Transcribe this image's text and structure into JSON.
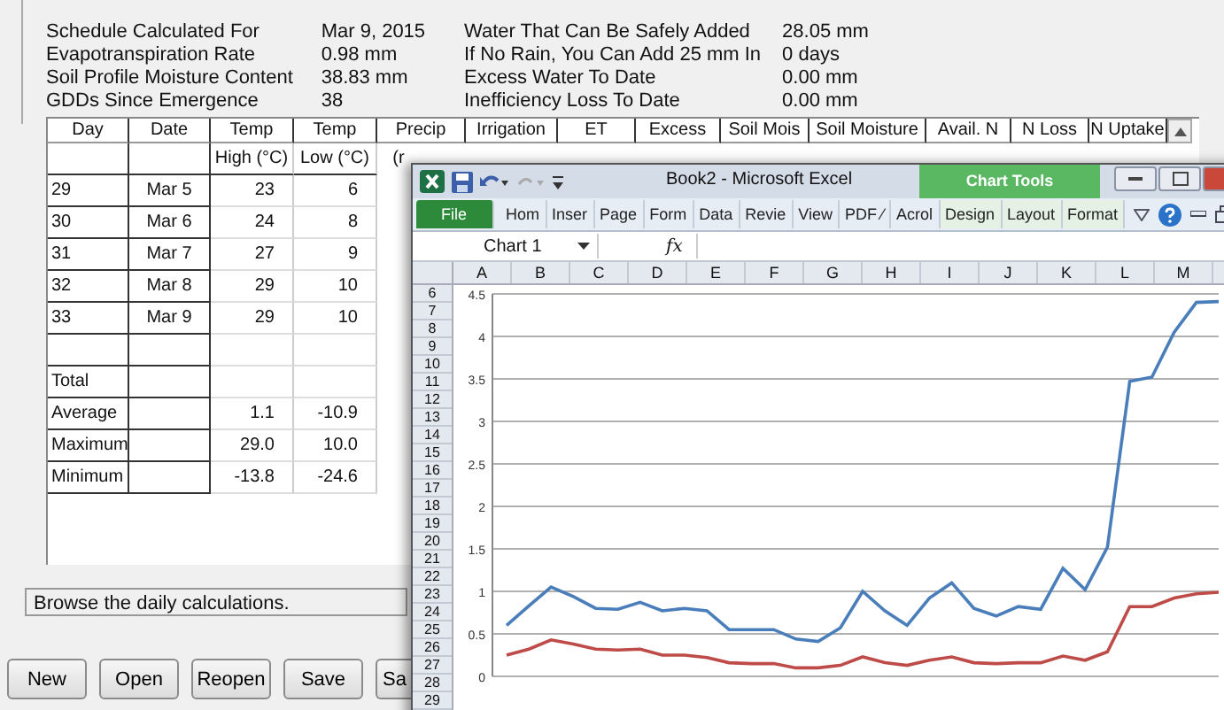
{
  "summary_left": [
    {
      "label": "Schedule Calculated For",
      "value": "Mar 9, 2015"
    },
    {
      "label": "Evapotranspiration Rate",
      "value": "0.98 mm"
    },
    {
      "label": "Soil Profile Moisture Content",
      "value": "38.83 mm"
    },
    {
      "label": "GDDs Since Emergence",
      "value": "38"
    }
  ],
  "summary_right": [
    {
      "label": "Water That Can Be Safely Added",
      "value": "28.05 mm"
    },
    {
      "label": "If No Rain, You Can Add 25 mm In",
      "value": "0 days"
    },
    {
      "label": "Excess Water To Date",
      "value": "0.00 mm"
    },
    {
      "label": "Inefficiency Loss To Date",
      "value": "0.00 mm"
    }
  ],
  "table": {
    "columns": [
      "Day",
      "Date",
      "Temp",
      "Temp",
      "Precip",
      "Irrigation",
      "ET",
      "Excess",
      "Soil Mois",
      "Soil Moisture",
      "Avail. N",
      "N Loss",
      "N Uptake"
    ],
    "subheaders": [
      "High (°C)",
      "Low (°C)",
      "(r"
    ],
    "rows": [
      {
        "day": "29",
        "date": "Mar 5",
        "high": "23",
        "low": "6"
      },
      {
        "day": "30",
        "date": "Mar 6",
        "high": "24",
        "low": "8"
      },
      {
        "day": "31",
        "date": "Mar 7",
        "high": "27",
        "low": "9"
      },
      {
        "day": "32",
        "date": "Mar 8",
        "high": "29",
        "low": "10"
      },
      {
        "day": "33",
        "date": "Mar 9",
        "high": "29",
        "low": "10"
      }
    ],
    "totals": [
      {
        "label": "Total"
      },
      {
        "label": "Average",
        "high": "1.1",
        "low": "-10.9"
      },
      {
        "label": "Maximum",
        "high": "29.0",
        "low": "10.0"
      },
      {
        "label": "Minimum",
        "high": "-13.8",
        "low": "-24.6"
      }
    ]
  },
  "status_bar": "Browse the daily calculations.",
  "buttons": [
    "New",
    "Open",
    "Reopen",
    "Save",
    "Sa"
  ],
  "excel": {
    "title": "Book2 - Microsoft Excel",
    "context_tab": "Chart Tools",
    "ribbon_tabs": [
      {
        "label": "File",
        "kind": "file"
      },
      {
        "label": "Hom",
        "kind": "tab"
      },
      {
        "label": "Inser",
        "kind": "tab"
      },
      {
        "label": "Page",
        "kind": "tab"
      },
      {
        "label": "Form",
        "kind": "tab"
      },
      {
        "label": "Data",
        "kind": "tab"
      },
      {
        "label": "Revie",
        "kind": "tab"
      },
      {
        "label": "View",
        "kind": "tab"
      },
      {
        "label": "PDF ⁄",
        "kind": "tab"
      },
      {
        "label": "Acrol",
        "kind": "tab"
      },
      {
        "label": "Design",
        "kind": "context"
      },
      {
        "label": "Layout",
        "kind": "context"
      },
      {
        "label": "Format",
        "kind": "context"
      }
    ],
    "name_box": "Chart 1",
    "fx": "fx",
    "column_headers": [
      "A",
      "B",
      "C",
      "D",
      "E",
      "F",
      "G",
      "H",
      "I",
      "J",
      "K",
      "L",
      "M"
    ],
    "row_headers": [
      "6",
      "7",
      "8",
      "9",
      "10",
      "11",
      "12",
      "13",
      "14",
      "15",
      "16",
      "17",
      "18",
      "19",
      "20",
      "21",
      "22",
      "23",
      "24",
      "25",
      "26",
      "27",
      "28",
      "29"
    ],
    "chart_data": {
      "type": "line",
      "grid": true,
      "ylim": [
        0,
        4.5
      ],
      "yticks": [
        0,
        0.5,
        1,
        1.5,
        2,
        2.5,
        3,
        3.5,
        4,
        4.5
      ],
      "series": [
        {
          "color": "#4a7ebb",
          "values": [
            0.6,
            0.83,
            1.05,
            0.94,
            0.8,
            0.79,
            0.87,
            0.77,
            0.8,
            0.77,
            0.55,
            0.55,
            0.55,
            0.44,
            0.41,
            0.57,
            1.0,
            0.77,
            0.6,
            0.92,
            1.1,
            0.8,
            0.71,
            0.82,
            0.79,
            1.27,
            1.02,
            1.52,
            3.47,
            3.52,
            4.05,
            4.4,
            4.41
          ]
        },
        {
          "color": "#be4b48",
          "values": [
            0.25,
            0.32,
            0.43,
            0.38,
            0.32,
            0.31,
            0.32,
            0.25,
            0.25,
            0.22,
            0.16,
            0.15,
            0.15,
            0.1,
            0.1,
            0.13,
            0.23,
            0.16,
            0.13,
            0.19,
            0.23,
            0.16,
            0.15,
            0.16,
            0.16,
            0.24,
            0.19,
            0.29,
            0.82,
            0.82,
            0.92,
            0.97,
            0.99
          ]
        }
      ]
    }
  }
}
